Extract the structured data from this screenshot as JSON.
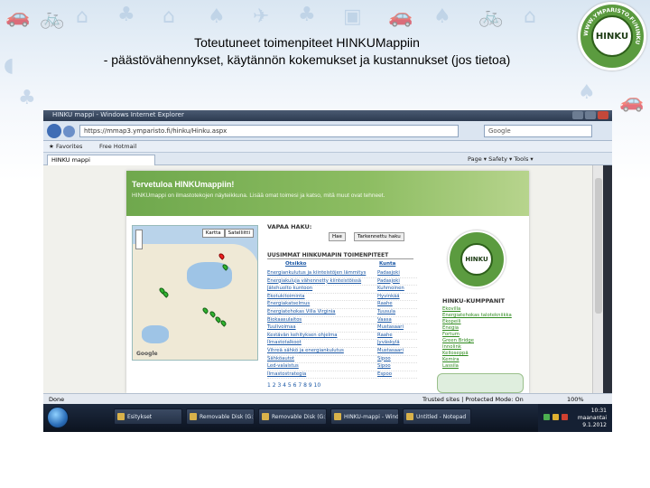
{
  "slide": {
    "title_line1": "Toteutuneet toimenpiteet HINKUMappiin",
    "title_line2": "- päästövähennykset, käytännön kokemukset ja kustannukset (jos tietoa)",
    "logo_text": "HINKU",
    "logo_ring_text": "WWW.YMPARISTO.FI/HINKU"
  },
  "browser": {
    "window_title": "HINKU mappi - Windows Internet Explorer",
    "url": "https://mmap3.ymparisto.fi/hinku/Hinku.aspx",
    "search_placeholder": "Google",
    "favorites_label": "Favorites",
    "free_hotmail": "Free Hotmail",
    "tab_title": "HINKU mappi",
    "toolbar_tools": "Page ▾  Safety ▾  Tools ▾",
    "status_left": "Done",
    "status_right": "Trusted sites | Protected Mode: On",
    "zoom": "100%"
  },
  "page": {
    "banner_heading": "Tervetuloa HINKUmappiin!",
    "banner_sub": "HINKUmappi on ilmastotekojen näyteikkuna. Lisää omat toimesi ja katso, mitä muut ovat tehneet.",
    "quick_search": "VAPAA HAKU:",
    "btn_search": "Hae",
    "btn_advanced": "Tarkennettu haku",
    "list_heading": "UUSIMMAT HINKUMAPIN TOIMENPITEET",
    "col_title": "Otsikko",
    "col_municipality": "Kunta",
    "map_tab_map": "Kartta",
    "map_tab_satellite": "Satelliitti",
    "map_google": "Google",
    "rows": [
      {
        "title": "Energiankulutus ja kiinteistöjen lämmitys",
        "municipality": "Padasjoki"
      },
      {
        "title": "Energiakuluja vähennetty kiinteistöissä",
        "municipality": "Padasjoki"
      },
      {
        "title": "Jätehuolto kuntoon",
        "municipality": "Kuhmoinen"
      },
      {
        "title": "Ekotukitoiminta",
        "municipality": "Hyvinkää"
      },
      {
        "title": "Energiakatselmus",
        "municipality": "Raahe"
      },
      {
        "title": "Energiatehokas Villa Virginia",
        "municipality": "Tuusula"
      },
      {
        "title": "Biokaasulaitos",
        "municipality": "Vaasa"
      },
      {
        "title": "Tuulivoimaa",
        "municipality": "Mustasaari"
      },
      {
        "title": "Kestävän kehityksen ohjelma",
        "municipality": "Raahe"
      },
      {
        "title": "Ilmastotalkoot",
        "municipality": "Jyväskylä"
      },
      {
        "title": "Vihreä sähkö ja energiankulutus",
        "municipality": "Mustasaari"
      },
      {
        "title": "Sähköautot",
        "municipality": "Sipoo"
      },
      {
        "title": "Led-valaistus",
        "municipality": "Sipoo"
      },
      {
        "title": "Ilmastostrategia",
        "municipality": "Espoo"
      }
    ],
    "pager": "1 2 3 4 5 6 7 8 9 10",
    "partners_heading": "HINKU-KUMPPANIT",
    "partners": [
      "Ekovilla",
      "Energiatehokas talotekniikka",
      "Ekopeili",
      "Enegia",
      "Fortum",
      "Green Bridge",
      "Innolink",
      "Kelloseppä",
      "Kemira",
      "Lassila"
    ]
  },
  "taskbar": {
    "items": [
      "Esitykset",
      "Removable Disk (G:)",
      "Removable Disk (G:)",
      "HINKU-mappi - Wind...",
      "Untitled - Notepad"
    ],
    "clock_time": "10:31",
    "clock_day": "maanantai",
    "clock_date": "9.1.2012"
  },
  "colors": {
    "hinku_green": "#5b9b3f",
    "link_blue": "#1a57a5"
  }
}
